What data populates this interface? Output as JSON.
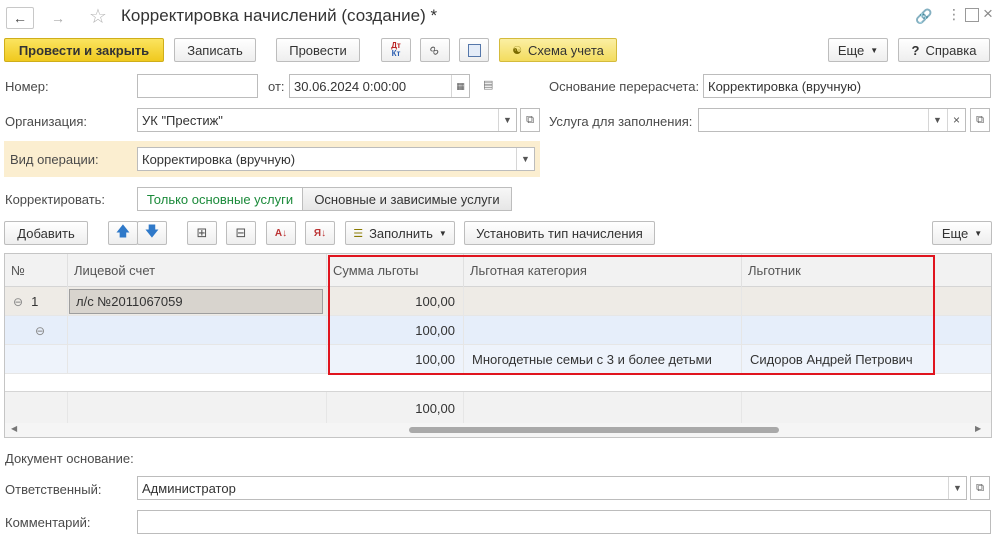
{
  "window": {
    "title": "Корректировка начислений (создание) *"
  },
  "toolbar": {
    "post_close": "Провести и закрыть",
    "save": "Записать",
    "post": "Провести",
    "dtkt_top": "Дт",
    "dtkt_bottom": "Кт",
    "scheme": "Схема учета",
    "more": "Еще",
    "help": "Справка"
  },
  "form": {
    "number_label": "Номер:",
    "number_value": "",
    "date_label": "от:",
    "date_value": "30.06.2024  0:00:00",
    "basis_label": "Основание перерасчета:",
    "basis_value": "Корректировка (вручную)",
    "org_label": "Организация:",
    "org_value": "УК \"Престиж\"",
    "service_label": "Услуга для заполнения:",
    "service_value": "",
    "optype_label": "Вид операции:",
    "optype_value": "Корректировка (вручную)",
    "correct_label": "Корректировать:",
    "correct_opt1": "Только основные услуги",
    "correct_opt2": "Основные и зависимые услуги"
  },
  "table_toolbar": {
    "add": "Добавить",
    "fill": "Заполнить",
    "set_type": "Установить тип начисления",
    "more": "Еще"
  },
  "table": {
    "columns": [
      "№",
      "Лицевой счет",
      "Сумма льготы",
      "Льготная категория",
      "Льготник"
    ],
    "rows": [
      {
        "n": "1",
        "account": "л/с №2011067059",
        "amount": "100,00",
        "category": "",
        "person": ""
      },
      {
        "n": "",
        "account": "",
        "amount": "100,00",
        "category": "",
        "person": ""
      },
      {
        "n": "",
        "account": "",
        "amount": "100,00",
        "category": "Многодетные семьи с 3 и более детьми",
        "person": "Сидоров Андрей Петрович"
      }
    ],
    "total": "100,00"
  },
  "footer": {
    "doc_basis_label": "Документ основание:",
    "responsible_label": "Ответственный:",
    "responsible_value": "Администратор",
    "comment_label": "Комментарий:",
    "comment_value": ""
  },
  "colors": {
    "primary": "#f0c91e",
    "highlight_box": "#e0141e",
    "optype_band": "#fbeed0",
    "selected_row": "#e6eefa",
    "radio_active_text": "#1b8a3a"
  }
}
